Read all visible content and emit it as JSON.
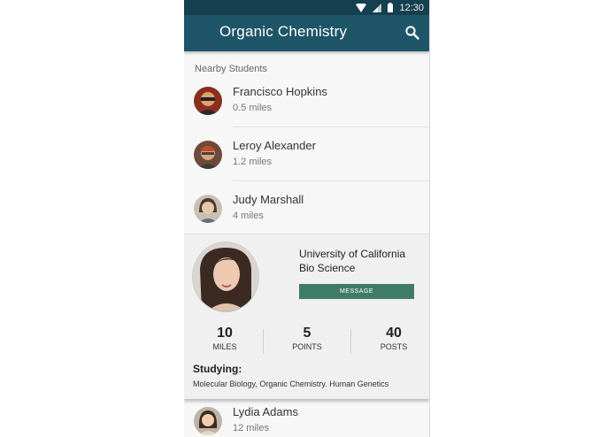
{
  "status_bar": {
    "time": "12:30",
    "icons": [
      "wifi-icon",
      "signal-icon",
      "battery-icon"
    ]
  },
  "app_bar": {
    "title": "Organic Chemistry",
    "action_icon": "search-icon"
  },
  "nearby": {
    "section_label": "Nearby Students",
    "students": [
      {
        "name": "Francisco Hopkins",
        "distance": "0.5 miles"
      },
      {
        "name": "Leroy Alexander",
        "distance": "1.2 miles"
      },
      {
        "name": "Judy Marshall",
        "distance": "4 miles"
      }
    ]
  },
  "profile": {
    "university": "University of California",
    "program": "Bio Science",
    "message_label": "MESSAGE",
    "stats": [
      {
        "value": "10",
        "label": "MILES"
      },
      {
        "value": "5",
        "label": "POINTS"
      },
      {
        "value": "40",
        "label": "POSTS"
      }
    ],
    "studying_label": "Studying:",
    "studying_text": "Molecular Biology, Organic Chemistry. Human Genetics"
  },
  "more_students": [
    {
      "name": "Lydia Adams",
      "distance": "12 miles"
    }
  ],
  "colors": {
    "status_bar": "#14404f",
    "app_bar": "#1f5568",
    "message_button": "#3e7c67"
  }
}
